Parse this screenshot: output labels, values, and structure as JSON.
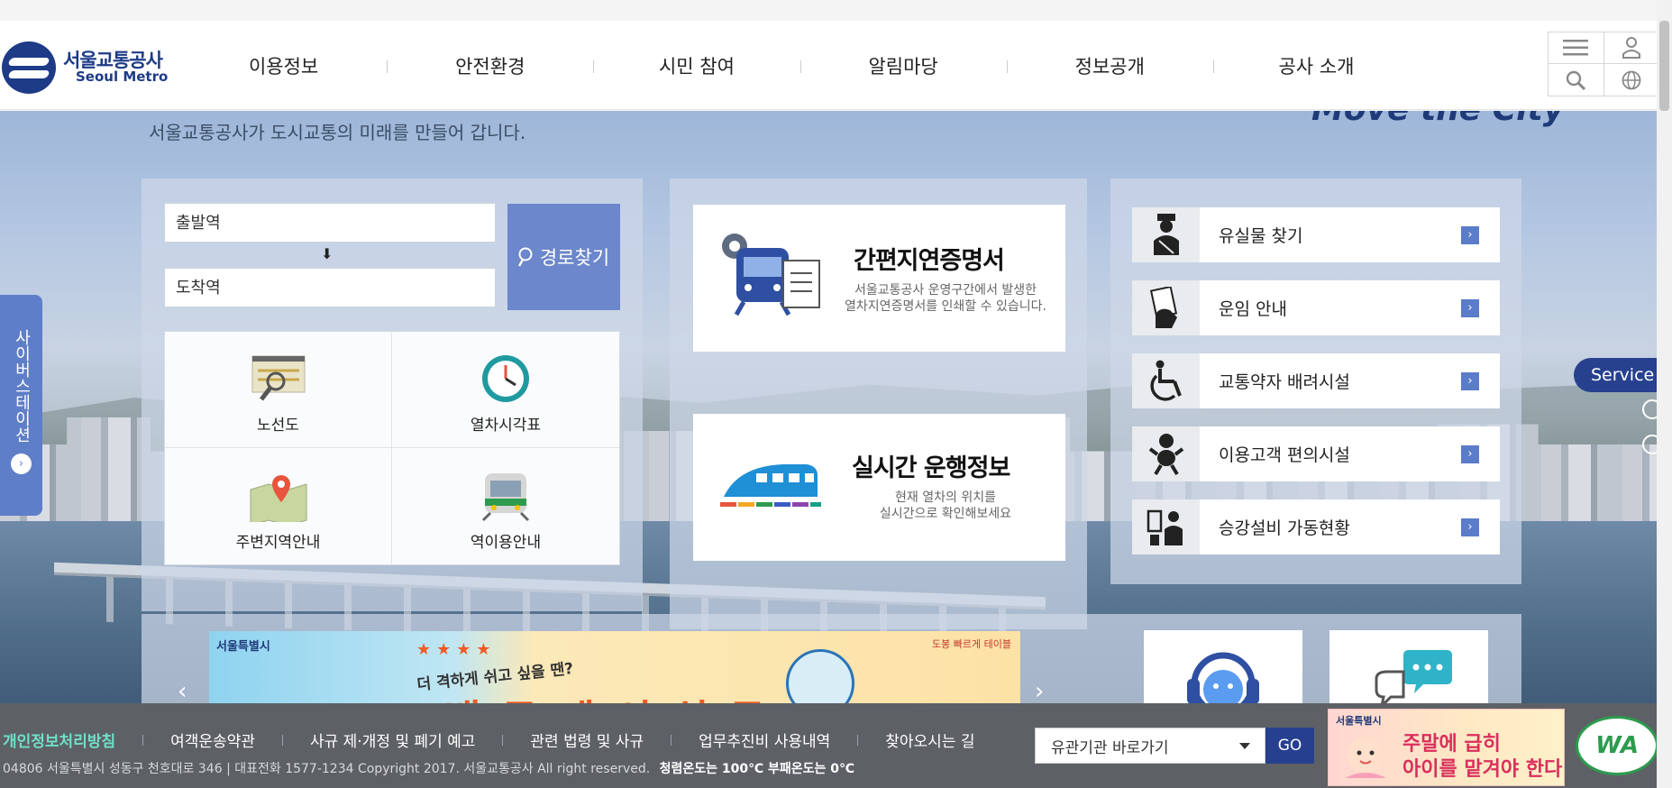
{
  "brand": {
    "logo_ko": "서울교통공사",
    "logo_en": "Seoul Metro",
    "primary_color": "#1d3b86",
    "accent_color": "#6c87cb"
  },
  "nav": {
    "items": [
      "이용정보",
      "안전환경",
      "시민 참여",
      "알림마당",
      "정보공개",
      "공사 소개"
    ]
  },
  "utility": {
    "icons": [
      "menu-icon",
      "user-icon",
      "search-icon",
      "globe-icon"
    ]
  },
  "hero": {
    "slogan": "서울교통공사가 도시교통의 미래를 만들어 갑니다.",
    "move_text": "Move the City"
  },
  "route": {
    "from_placeholder": "출발역",
    "to_placeholder": "도착역",
    "arrow": "⬇",
    "button_label": "경로찾기"
  },
  "quick_links": [
    {
      "label": "노선도",
      "icon": "route-map-icon"
    },
    {
      "label": "열차시각표",
      "icon": "clock-icon"
    },
    {
      "label": "주변지역안내",
      "icon": "map-pin-icon"
    },
    {
      "label": "역이용안내",
      "icon": "train-front-icon"
    }
  ],
  "cards": [
    {
      "title": "간편지연증명서",
      "desc1": "서울교통공사 운영구간에서 발생한",
      "desc2": "열차지연증명서를 인쇄할 수 있습니다.",
      "icon": "delay-certificate-icon"
    },
    {
      "title": "실시간 운행정보",
      "desc1": "현재 열차의 위치를",
      "desc2": "실시간으로 확인해보세요",
      "icon": "bullet-train-icon"
    }
  ],
  "services": [
    {
      "label": "유실물 찾기",
      "icon": "officer-icon"
    },
    {
      "label": "운임 안내",
      "icon": "ticket-hand-icon"
    },
    {
      "label": "교통약자 배려시설",
      "icon": "wheelchair-icon"
    },
    {
      "label": "이용고객 편의시설",
      "icon": "baby-icon"
    },
    {
      "label": "승강설비 가동현황",
      "icon": "elevator-user-icon"
    }
  ],
  "side_tab": {
    "label": "사이버스테이션",
    "arrow": "›"
  },
  "service_tab": {
    "label": "Service"
  },
  "banner": {
    "org": "서울특별시",
    "sub": "더 격하게 쉬고 싶을 땐?",
    "headline": "\"배·큐·데·서·싱·큐!\"",
    "stars": "★★★★",
    "note": "도봉 빠르게 테이블"
  },
  "carousel": {
    "prev": "‹",
    "next": "›"
  },
  "footer": {
    "links": [
      "개인정보처리방침",
      "여객운송약관",
      "사규 제·개정 및 폐기 예고",
      "관련 법령 및 사규",
      "업무추진비 사용내역",
      "찾아오시는 길"
    ],
    "address": "04806 서울특별시 성동구 천호대로 346 | 대표전화 1577-1234 Copyright 2017. 서울교통공사 All right reserved.",
    "temp": "청렴온도는 100℃ 부패온도는 0℃",
    "select_label": "유관기관 바로가기",
    "go_label": "GO",
    "promo_org": "서울특별시",
    "promo_line1": "주말에 급히",
    "promo_line2": "아이를 맡겨야 한다면?",
    "wa_mark": "WA"
  }
}
